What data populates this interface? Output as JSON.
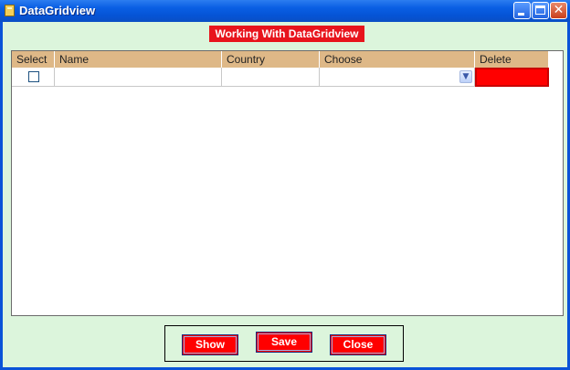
{
  "window": {
    "title": "DataGridview"
  },
  "form": {
    "heading": "Working With DataGridview"
  },
  "grid": {
    "columns": [
      "Select",
      "Name",
      "Country",
      "Choose",
      "Delete"
    ],
    "rows": [
      {
        "select": false,
        "name": "",
        "country": "",
        "choose": "",
        "delete": ""
      }
    ]
  },
  "buttons": {
    "show": "Show",
    "save": "Save",
    "close": "Close"
  },
  "colors": {
    "form_background": "#dcf5dc",
    "header_background": "#deb887",
    "accent_red": "#ff0000",
    "titlebar_blue": "#0a5fe4"
  },
  "icons": {
    "window_controls": [
      "minimize-icon",
      "maximize-icon",
      "close-icon"
    ],
    "combo": "chevron-down-icon",
    "app": "form-icon"
  }
}
